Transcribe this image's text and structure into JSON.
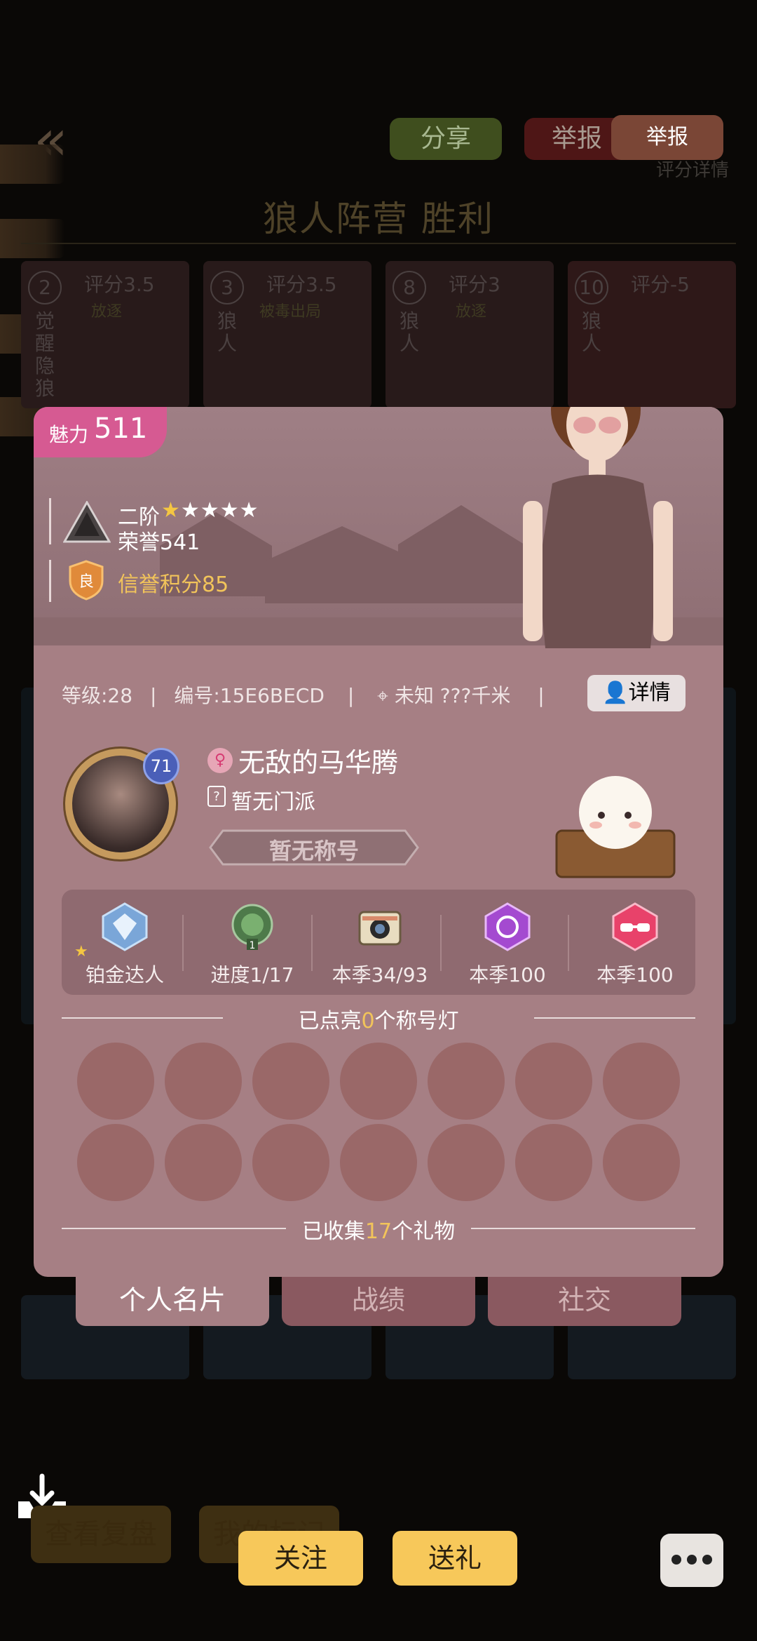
{
  "header": {
    "share": "分享",
    "report_bg": "举报",
    "report": "举报",
    "score_detail": "评分详情",
    "result_title": "狼人阵营  胜利"
  },
  "players": [
    {
      "num": "2",
      "score": "评分3.5",
      "role": "觉醒隐狼",
      "tag": "放逐"
    },
    {
      "num": "3",
      "score": "评分3.5",
      "role": "狼人",
      "tag": "被毒出局"
    },
    {
      "num": "8",
      "score": "评分3",
      "role": "狼人",
      "tag": "放逐"
    },
    {
      "num": "10",
      "score": "评分-5",
      "role": "狼人",
      "tag": ""
    }
  ],
  "card": {
    "charm_label": "魅力",
    "charm_value": "511",
    "rank_tier": "二阶",
    "honor": "荣誉541",
    "credit_badge": "良",
    "credit": "信誉积分85",
    "info_level": "等级:28",
    "info_id": "编号:15E6BECD",
    "info_location": "未知 ???千米",
    "detail_btn": "详情",
    "avatar_level": "71",
    "nickname": "无敌的马华腾",
    "sect": "暂无门派",
    "title_plate": "暂无称号"
  },
  "achievements": [
    {
      "label": "铂金达人",
      "icon": "platinum-wolf-badge"
    },
    {
      "label": "进度1/17",
      "icon": "green-medal",
      "badge_num": "1"
    },
    {
      "label": "本季34/93",
      "icon": "camera-icon"
    },
    {
      "label": "本季100",
      "icon": "rose-hexagon"
    },
    {
      "label": "本季100",
      "icon": "sunglasses-hexagon"
    }
  ],
  "lamps": {
    "prefix": "已点亮",
    "count": "0",
    "suffix": "个称号灯"
  },
  "gifts": {
    "prefix": "已收集",
    "count": "17",
    "suffix": "个礼物"
  },
  "tabs": [
    {
      "label": "个人名片"
    },
    {
      "label": "战绩"
    },
    {
      "label": "社交"
    }
  ],
  "bottom": {
    "replay": "查看复盘",
    "mine": "我的标记",
    "follow": "关注",
    "gift": "送礼"
  },
  "colors": {
    "card": "#a67f84",
    "charm": "#d65a92",
    "accent_yellow": "#f7c85a",
    "highlight": "#f2c45a"
  }
}
